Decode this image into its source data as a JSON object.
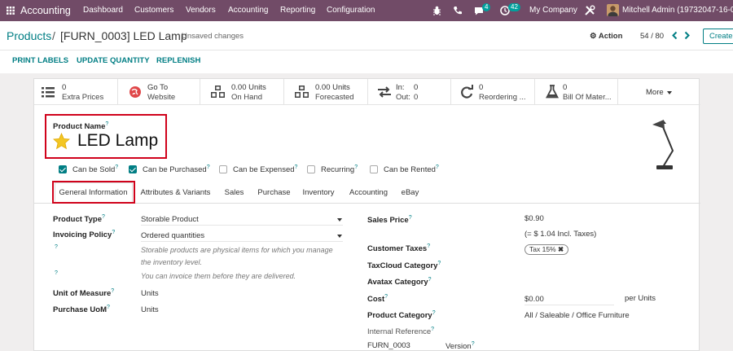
{
  "topbar": {
    "app": "Accounting",
    "menu": [
      "Dashboard",
      "Customers",
      "Vendors",
      "Accounting",
      "Reporting",
      "Configuration"
    ],
    "chat_count": "4",
    "activity_count": "42",
    "company": "My Company",
    "user": "Mitchell Admin (19732047-16-0-a"
  },
  "breadcrumb": {
    "parent": "Products",
    "sep": "/",
    "current": "[FURN_0003] LED Lamp",
    "unsaved": "Unsaved changes",
    "action": "Action",
    "pager": "54 / 80",
    "create": "Create"
  },
  "actions": [
    "PRINT LABELS",
    "UPDATE QUANTITY",
    "REPLENISH"
  ],
  "smart_buttons": [
    {
      "l1": "0",
      "l2": "Extra Prices",
      "icon": "list-icon"
    },
    {
      "l1": "Go To",
      "l2": "Website",
      "icon": "globe-icon"
    },
    {
      "l1": "0.00 Units",
      "l2": "On Hand",
      "icon": "cubes-icon"
    },
    {
      "l1": "0.00 Units",
      "l2": "Forecasted",
      "icon": "cubes-icon"
    },
    {
      "l1": "In:",
      "l1b": "0",
      "l2": "Out:",
      "l2b": "0",
      "icon": "exchange-icon"
    },
    {
      "l1": "0",
      "l2": "Reordering ...",
      "icon": "refresh-icon"
    },
    {
      "l1": "0",
      "l2": "Bill Of Mater...",
      "icon": "flask-icon"
    }
  ],
  "more": "More",
  "product": {
    "name_label": "Product Name",
    "name": "LED Lamp",
    "q": "?"
  },
  "checks": [
    {
      "label": "Can be Sold",
      "on": true
    },
    {
      "label": "Can be Purchased",
      "on": true
    },
    {
      "label": "Can be Expensed",
      "on": false
    },
    {
      "label": "Recurring",
      "on": false
    },
    {
      "label": "Can be Rented",
      "on": false
    }
  ],
  "tabs": [
    "General Information",
    "Attributes & Variants",
    "Sales",
    "Purchase",
    "Inventory",
    "Accounting",
    "eBay"
  ],
  "left": {
    "product_type_label": "Product Type",
    "product_type": "Storable Product",
    "invoicing_label": "Invoicing Policy",
    "invoicing": "Ordered quantities",
    "hint1a": "Storable products are physical items for which you manage",
    "hint1b": "the inventory level.",
    "hint2": "You can invoice them before they are delivered.",
    "uom_label": "Unit of Measure",
    "uom": "Units",
    "puom_label": "Purchase UoM",
    "puom": "Units"
  },
  "right": {
    "sales_price_label": "Sales Price",
    "sales_price": "$0.90",
    "incl_tax": "(= $ 1.04 Incl. Taxes)",
    "customer_taxes_label": "Customer Taxes",
    "tax_tag": "Tax 15%",
    "taxcloud_label": "TaxCloud Category",
    "avatax_label": "Avatax Category",
    "cost_label": "Cost",
    "cost": "$0.00",
    "per_units": "per Units",
    "category_label": "Product Category",
    "category": "All / Saleable / Office Furniture",
    "internal_ref_label": "Internal Reference",
    "internal_ref": "FURN_0003",
    "version_label": "Version"
  }
}
